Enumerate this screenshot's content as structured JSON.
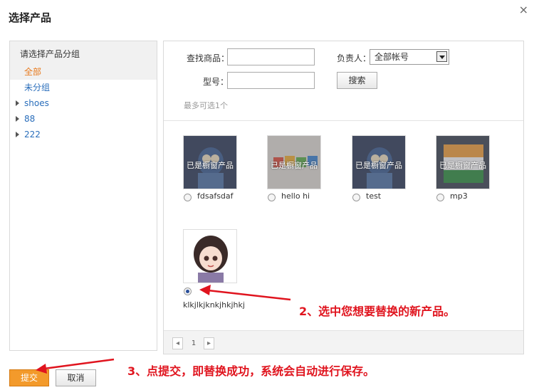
{
  "dialog": {
    "title": "选择产品",
    "close_glyph": "×"
  },
  "left_panel": {
    "header": "请选择产品分组",
    "groups": [
      {
        "label": "全部",
        "active": true,
        "expandable": false
      },
      {
        "label": "未分组",
        "active": false,
        "expandable": false
      },
      {
        "label": "shoes",
        "active": false,
        "expandable": true
      },
      {
        "label": "88",
        "active": false,
        "expandable": true
      },
      {
        "label": "222",
        "active": false,
        "expandable": true
      }
    ]
  },
  "search": {
    "product_label": "查找商品：",
    "product_value": "",
    "owner_label": "负责人：",
    "owner_selected": "全部帐号",
    "model_label": "型号：",
    "model_value": "",
    "search_button": "搜索",
    "hint": "最多可选1个"
  },
  "products": [
    {
      "name": "fdsafsdaf",
      "tag": "已是橱窗产品",
      "checked": false
    },
    {
      "name": "hello hi",
      "tag": "已是橱窗产品",
      "checked": false
    },
    {
      "name": "test",
      "tag": "已是橱窗产品",
      "checked": false
    },
    {
      "name": "mp3",
      "tag": "已是橱窗产品",
      "checked": false
    },
    {
      "name": "klkjlkjknkjhkjhkj",
      "tag": "",
      "checked": true
    }
  ],
  "pager": {
    "prev": "◂",
    "page": "1",
    "next": "▸"
  },
  "footer": {
    "submit": "提交",
    "cancel": "取消"
  },
  "annotations": {
    "step2": "2、选中您想要替换的新产品。",
    "step3": "3、点提交，即替换成功，系统会自动进行保存。"
  },
  "colors": {
    "accent_orange": "#f39a2b",
    "active_group": "#e8791c",
    "link_blue": "#2a6ebb",
    "annotation_red": "#e0141e"
  }
}
